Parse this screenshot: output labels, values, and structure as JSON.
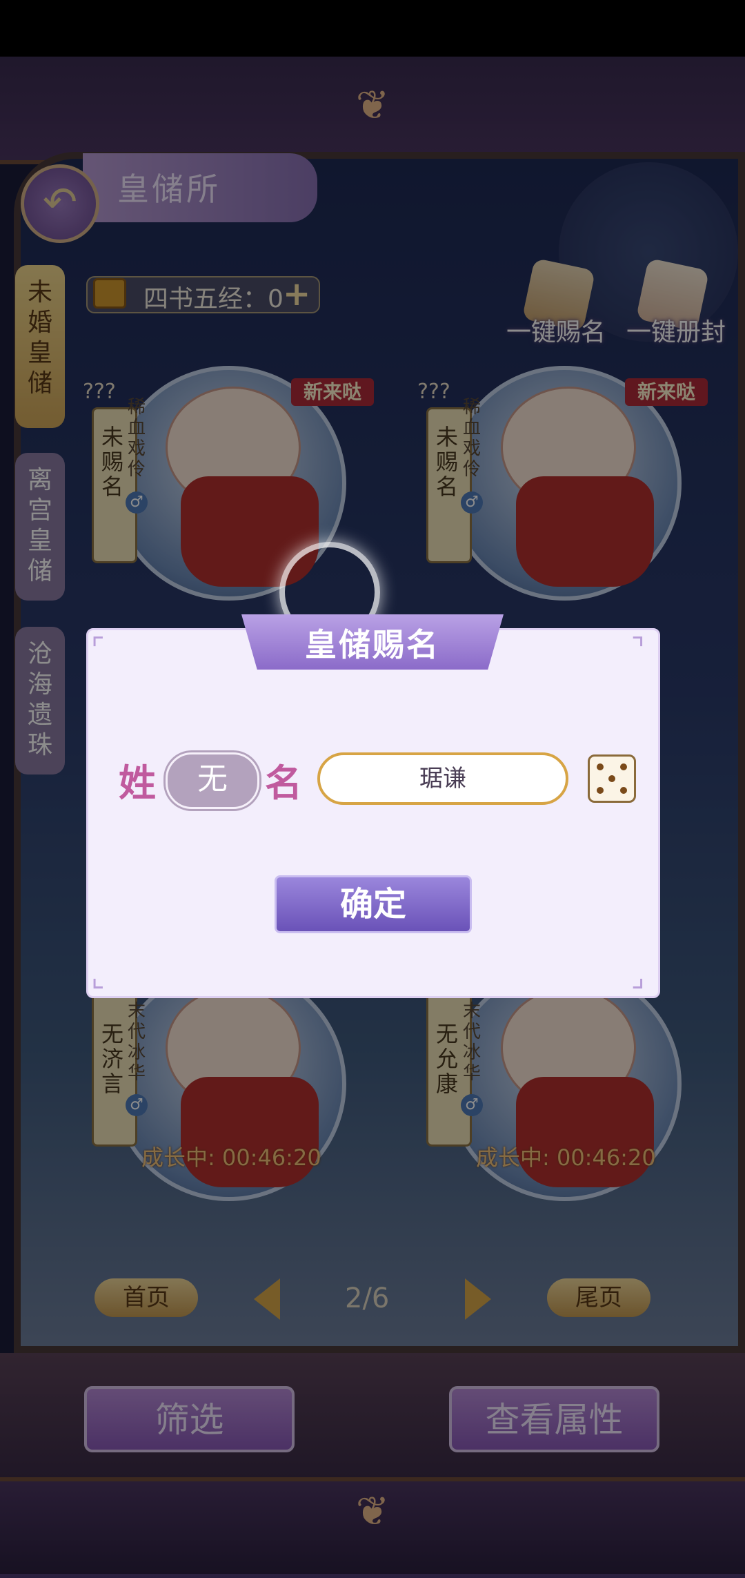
{
  "header": {
    "title": "皇储所"
  },
  "sidebar": {
    "tabs": [
      {
        "label": "未婚皇储"
      },
      {
        "label": "离宫皇储"
      },
      {
        "label": "沧海遗珠"
      }
    ]
  },
  "currency": {
    "label": "四书五经：0"
  },
  "actions": {
    "name_all": "一键赐名",
    "title_all": "一键册封"
  },
  "cards": [
    {
      "name": "未赐名",
      "trait": "稀血戏伶",
      "unknown": "???",
      "tag": "新来哒"
    },
    {
      "name": "未赐名",
      "trait": "稀血戏伶",
      "unknown": "???",
      "tag": "新来哒"
    },
    {
      "name": "无济言",
      "trait": "末代冰华",
      "status": "成长中: 00:46:20"
    },
    {
      "name": "无允康",
      "trait": "末代冰华",
      "status": "成长中: 00:46:20"
    }
  ],
  "pagination": {
    "first": "首页",
    "last": "尾页",
    "indicator": "2/6"
  },
  "bottom_buttons": {
    "filter": "筛选",
    "view_attributes": "查看属性"
  },
  "dialog": {
    "title": "皇储赐名",
    "surname_label": "姓",
    "surname_value": "无",
    "name_label": "名",
    "name_value": "琚谦",
    "confirm": "确定"
  },
  "icons": [
    "back-arrow-icon",
    "book-icon",
    "plus-icon",
    "dice-icon",
    "gender-icon"
  ]
}
